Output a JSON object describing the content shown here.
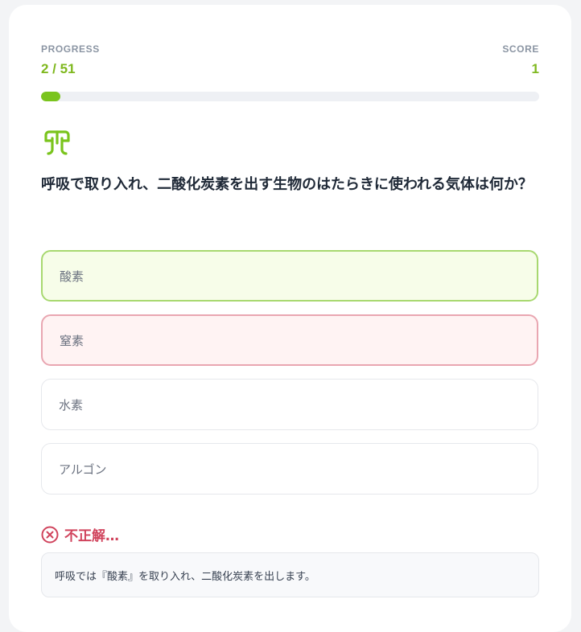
{
  "progress": {
    "label": "PROGRESS",
    "value": "2 / 51",
    "fraction": 0.039
  },
  "score": {
    "label": "SCORE",
    "value": "1"
  },
  "question": {
    "icon": "lungs-icon",
    "text": "呼吸で取り入れ、二酸化炭素を出す生物のはたらきに使われる気体は何か？"
  },
  "options": [
    {
      "label": "酸素",
      "state": "correct"
    },
    {
      "label": "窒素",
      "state": "wrong"
    },
    {
      "label": "水素",
      "state": "default"
    },
    {
      "label": "アルゴン",
      "state": "default"
    }
  ],
  "feedback": {
    "icon": "x-circle-icon",
    "text": "不正解…"
  },
  "explanation": {
    "text": "呼吸では『酸素』を取り入れ、二酸化炭素を出します。"
  },
  "colors": {
    "accent": "#7ac41d",
    "correct_border": "#a8d870",
    "wrong_border": "#e9a6b1",
    "error_text": "#d0435c"
  }
}
